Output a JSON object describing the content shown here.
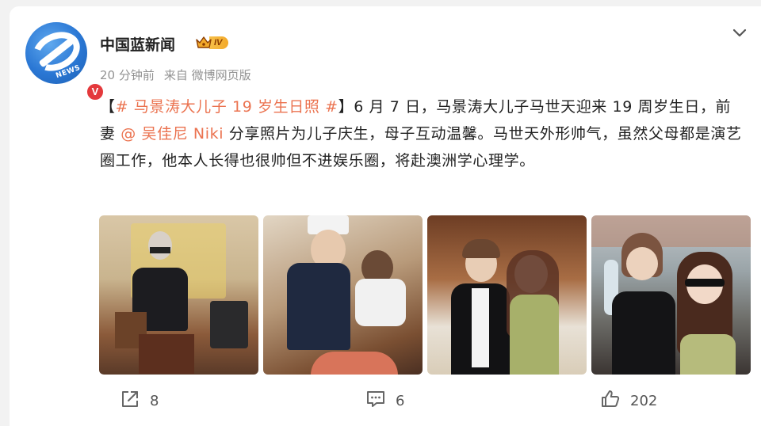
{
  "post": {
    "author": "中国蓝新闻",
    "level": "IV",
    "verified_mark": "V",
    "avatar_text": "NEWS",
    "time": "20 分钟前",
    "source": "来自 微博网页版",
    "content": {
      "bracket_open": "【",
      "topic": "# 马景涛大儿子 19 岁生日照 #",
      "bracket_close": "】",
      "text1": "6 月 7 日，马景涛大儿子马世天迎来 19 周岁生日，前妻 ",
      "mention": "@ 吴佳尼 Niki",
      "text2": " 分享照片为儿子庆生，母子互动温馨。马世天外形帅气，虽然父母都是演艺圈工作，他本人长得也很帅但不进娱乐圈，将赴澳洲学心理学。"
    }
  },
  "actions": {
    "share_count": "8",
    "comment_count": "6",
    "like_count": "202"
  },
  "icons": {
    "share": "share-icon",
    "comment": "comment-icon",
    "like": "thumbs-up-icon",
    "menu": "chevron-down-icon",
    "level": "crown-icon"
  },
  "colors": {
    "topic": "#eb7350",
    "mention": "#eb7350",
    "verified": "#e4393c",
    "level_badge": "#f3a92a"
  }
}
